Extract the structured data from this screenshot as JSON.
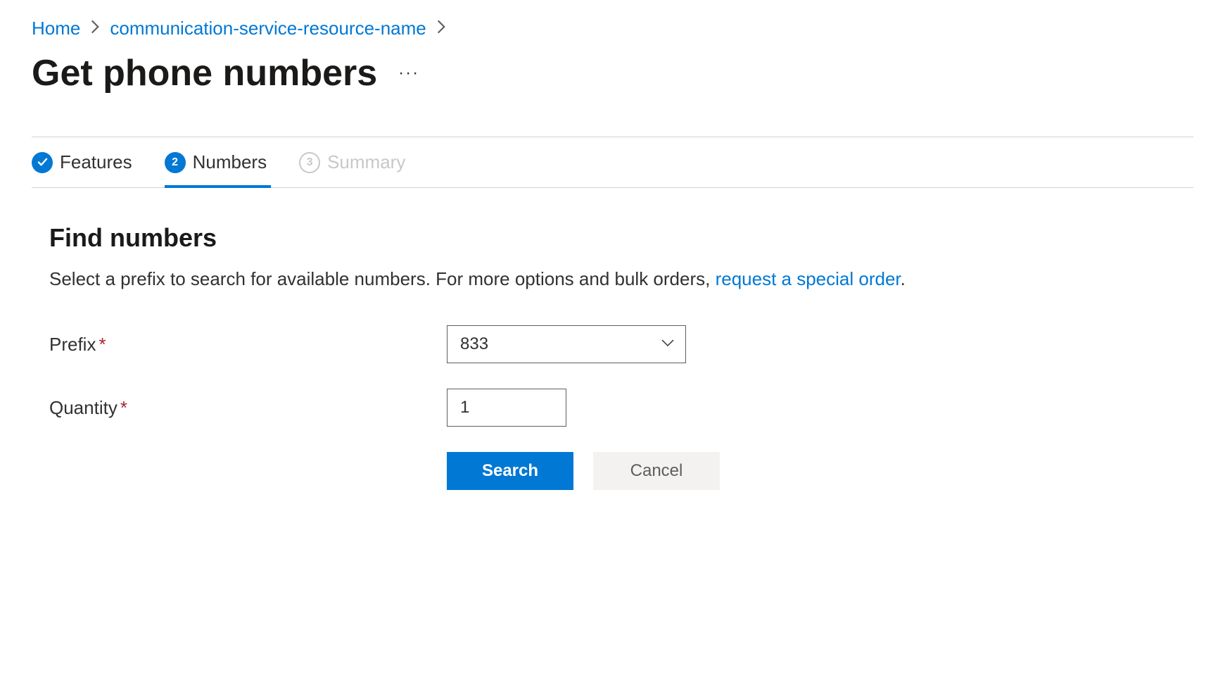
{
  "breadcrumb": {
    "items": [
      {
        "label": "Home"
      },
      {
        "label": "communication-service-resource-name"
      }
    ]
  },
  "page": {
    "title": "Get phone numbers"
  },
  "steps": [
    {
      "label": "Features",
      "state": "completed"
    },
    {
      "label": "Numbers",
      "state": "current",
      "number": "2"
    },
    {
      "label": "Summary",
      "state": "upcoming",
      "number": "3"
    }
  ],
  "section": {
    "title": "Find numbers",
    "description_prefix": "Select a prefix to search for available numbers. For more options and bulk orders, ",
    "description_link": "request a special order",
    "description_suffix": "."
  },
  "form": {
    "prefix": {
      "label": "Prefix",
      "value": "833"
    },
    "quantity": {
      "label": "Quantity",
      "value": "1"
    }
  },
  "buttons": {
    "search": "Search",
    "cancel": "Cancel"
  }
}
